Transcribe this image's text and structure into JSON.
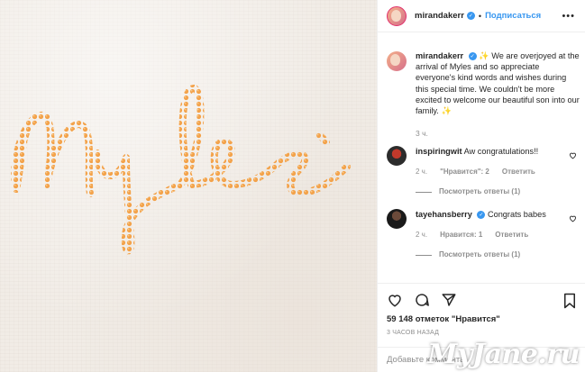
{
  "photo": {
    "embroidered_text": "Myles",
    "thread_color": "#f3a24a"
  },
  "header": {
    "username": "mirandakerr",
    "follow_label": "Подписаться",
    "more_icon": "more-horizontal-icon"
  },
  "caption": {
    "username": "mirandakerr",
    "text": "We are overjoyed at the arrival of Myles and so appreciate everyone's kind words and wishes during this special time. We couldn't be more excited to welcome our beautiful son into our family.",
    "time": "3 ч."
  },
  "comments": [
    {
      "username": "inspiringwit",
      "text": "Aw congratulations!!",
      "time": "2 ч.",
      "likes": "\"Нравится\": 2",
      "reply_label": "Ответить",
      "view_replies": "Посмотреть ответы (1)"
    },
    {
      "username": "tayehansberry",
      "text": "Congrats babes",
      "time": "2 ч.",
      "likes": "Нравится: 1",
      "reply_label": "Ответить",
      "view_replies": "Посмотреть ответы (1)"
    }
  ],
  "likes_count": "59 148 отметок \"Нравится\"",
  "posted_time": "3 ЧАСОВ НАЗАД",
  "add_comment_placeholder": "Добавьте коммента",
  "watermark": "MyJane.ru",
  "colors": {
    "accent_blue": "#3897f0",
    "text": "#262626",
    "muted": "#8e8e8e",
    "divider": "#efefef"
  }
}
